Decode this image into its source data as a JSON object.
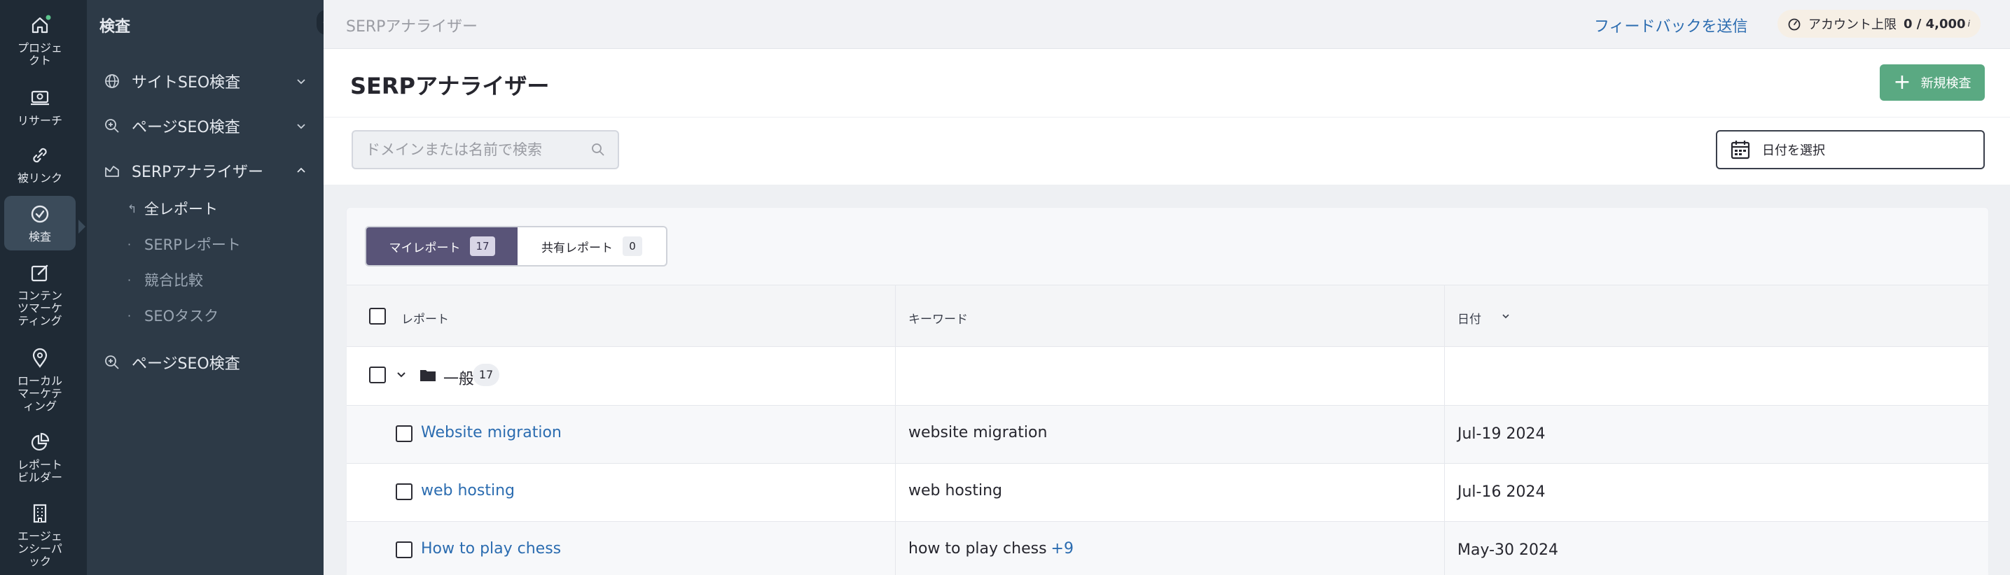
{
  "rail": [
    {
      "icon": "home-icon",
      "label": "プロジェ\nクト"
    },
    {
      "icon": "research-icon",
      "label": "リサーチ"
    },
    {
      "icon": "link-icon",
      "label": "被リンク"
    },
    {
      "icon": "audit-check-icon",
      "label": "検査"
    },
    {
      "icon": "content-edit-icon",
      "label": "コンテン\nツマーケ\nティング"
    },
    {
      "icon": "map-pin-icon",
      "label": "ローカル\nマーケテ\nィング"
    },
    {
      "icon": "pie-chart-icon",
      "label": "レポート\nビルダー"
    },
    {
      "icon": "building-icon",
      "label": "エージェ\nンシーパ\nック"
    }
  ],
  "panel": {
    "title": "検査",
    "nav": [
      {
        "label": "サイトSEO検査",
        "icon": "globe-icon"
      },
      {
        "label": "ページSEO検査",
        "icon": "magnify-plus-icon"
      },
      {
        "label": "SERPアナライザー",
        "icon": "serp-chart-icon"
      }
    ],
    "sub": [
      {
        "label": "全レポート",
        "bullet": "↰"
      },
      {
        "label": "SERPレポート",
        "bullet": "·"
      },
      {
        "label": "競合比較",
        "bullet": "·"
      },
      {
        "label": "SEOタスク",
        "bullet": "·"
      }
    ],
    "nav_bottom": {
      "label": "ページSEO検査",
      "icon": "magnify-plus-icon"
    }
  },
  "topbar": {
    "breadcrumb": "SERPアナライザー",
    "feedback": "フィードバックを送信",
    "account_label": "アカウント上限",
    "account_value": "0 / 4,000",
    "account_sup": "i"
  },
  "header": {
    "title": "SERPアナライザー",
    "new_button": "新規検査"
  },
  "toolbar": {
    "search_placeholder": "ドメインまたは名前で検索",
    "date_label": "日付を選択"
  },
  "tabs": [
    {
      "label": "マイレポート",
      "count": "17",
      "active": true
    },
    {
      "label": "共有レポート",
      "count": "0",
      "active": false
    }
  ],
  "table": {
    "headers": {
      "report": "レポート",
      "keyword": "キーワード",
      "date": "日付"
    },
    "group": {
      "name": "一般",
      "count": "17"
    },
    "rows": [
      {
        "report": "Website migration",
        "keyword": "website migration",
        "more": "",
        "date": "Jul-19 2024"
      },
      {
        "report": "web hosting",
        "keyword": "web hosting",
        "more": "",
        "date": "Jul-16 2024"
      },
      {
        "report": "How to play chess",
        "keyword": "how to play chess",
        "more": "+9",
        "date": "May-30 2024"
      }
    ]
  },
  "colors": {
    "rail_bg": "#1f2a35",
    "panel_bg": "#2d3a47",
    "accent_green": "#5aa982",
    "tab_active": "#595478",
    "link": "#2b6cb0"
  }
}
